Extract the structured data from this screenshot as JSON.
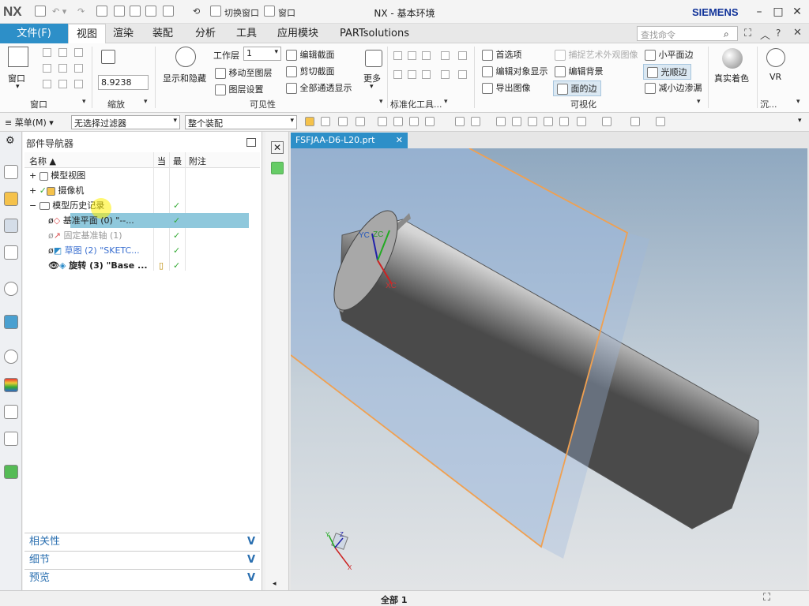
{
  "app": {
    "logo": "NX",
    "title": "NX - 基本环境",
    "brand": "SIEMENS",
    "quick_switch_window": "切换窗口",
    "quick_window": "窗口"
  },
  "menu": {
    "file": "文件(F)",
    "tabs": [
      "视图",
      "渲染",
      "装配",
      "分析",
      "工具",
      "应用模块",
      "PARTsolutions"
    ],
    "active_tab": "视图",
    "search_placeholder": "查找命令"
  },
  "ribbon": {
    "window_group": {
      "label": "窗口",
      "button": "窗口"
    },
    "zoom_group": {
      "label": "缩放",
      "value": "8.9238"
    },
    "visibility_group": {
      "label": "可见性",
      "show_hide": "显示和隐藏",
      "work_layer_label": "工作层",
      "work_layer_value": "1",
      "move_to_layer": "移动至图层",
      "layer_settings": "图层设置",
      "edit_section": "编辑截面",
      "clip_section": "剪切截面",
      "all_pass_display": "全部通透显示",
      "more": "更多"
    },
    "std_tools_label": "标准化工具...",
    "visualization_group": {
      "label": "可视化",
      "preferences": "首选项",
      "edit_object_display": "编辑对象显示",
      "export_image": "导出图像",
      "capture_art": "捕捉艺术外观图像",
      "edit_background": "编辑背景",
      "face_edges": "面的边",
      "small_plane_edge": "小平面边",
      "smooth_edge": "光顺边",
      "reduce_edge_leak": "减小边渗漏",
      "true_shading": "真实着色",
      "vr": "VR"
    },
    "immerse_label": "沉..."
  },
  "toolbar": {
    "menu_button": "菜单(M)",
    "filter_select": "无选择过滤器",
    "assembly_select": "整个装配"
  },
  "navigator": {
    "title": "部件导航器",
    "columns": {
      "name": "名称",
      "current": "当",
      "latest": "最",
      "comment": "附注"
    },
    "rows": [
      {
        "label": "模型视图",
        "check": ""
      },
      {
        "label": "摄像机",
        "check": ""
      },
      {
        "label": "模型历史记录",
        "check": "✓"
      },
      {
        "label": "基准平面 (0) \"--...",
        "check": "✓"
      },
      {
        "label": "固定基准轴 (1)",
        "check": "✓"
      },
      {
        "label": "草图 (2) \"SKETC...",
        "check": "✓"
      },
      {
        "label": "旋转 (3) \"Base ...",
        "check": "✓"
      }
    ],
    "accordions": [
      "相关性",
      "细节",
      "预览"
    ]
  },
  "graphics": {
    "file_tab": "FSFJAA-D6-L20.prt",
    "axis_labels": {
      "yc": "YC",
      "zc": "ZC",
      "xc": "XC"
    },
    "triad_labels": {
      "x": "X",
      "y": "Y",
      "z": "Z"
    }
  },
  "status": {
    "text": "全部 1"
  },
  "colors": {
    "accent": "#2d8fc8",
    "selected_row": "#8fc8dc",
    "plane_edge": "#f0a050",
    "check": "#33aa33"
  }
}
